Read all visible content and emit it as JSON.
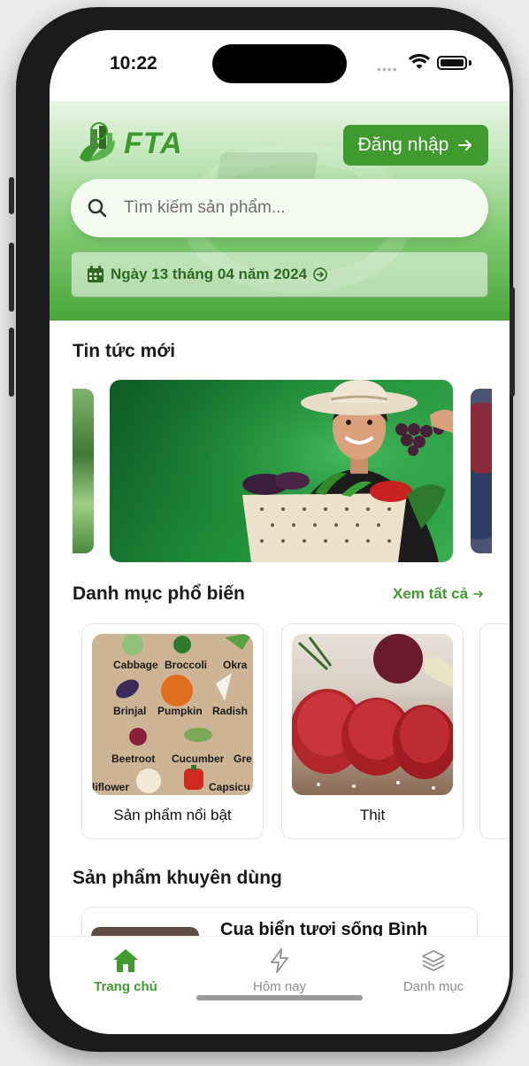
{
  "status_bar": {
    "time": "10:22"
  },
  "header": {
    "brand": "FTA",
    "login_label": "Đăng nhập",
    "search_placeholder": "Tìm kiếm sản phẩm...",
    "date_text": "Ngày 13 tháng 04 năm 2024"
  },
  "news": {
    "title": "Tin tức mới"
  },
  "categories": {
    "title": "Danh mục phổ biến",
    "see_all": "Xem tất cả",
    "items": [
      {
        "label": "Sản phẩm nổi bật"
      },
      {
        "label": "Thịt"
      }
    ],
    "veg_words": [
      "Cabbage",
      "Broccoli",
      "Okra",
      "Brinjal",
      "Pumpkin",
      "Radish",
      "Beetroot",
      "Cucumber",
      "Gre",
      "liflower",
      "Capsicu"
    ]
  },
  "recommended": {
    "title": "Sản phẩm khuyên dùng",
    "items": [
      {
        "name": "Cua biển tươi sống Bình"
      }
    ]
  },
  "bottom_nav": {
    "items": [
      {
        "label": "Trang chủ",
        "icon": "home-icon",
        "active": true
      },
      {
        "label": "Hôm nay",
        "icon": "lightning-icon",
        "active": false
      },
      {
        "label": "Danh mục",
        "icon": "layers-icon",
        "active": false
      }
    ]
  },
  "colors": {
    "accent": "#3f9b2e",
    "header_dark": "#4aa53b",
    "header_light": "#e7f5e3"
  }
}
